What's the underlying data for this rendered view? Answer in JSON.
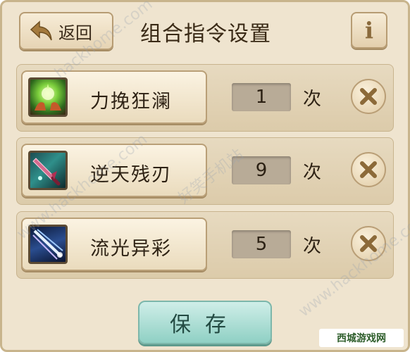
{
  "header": {
    "back_label": "返回",
    "title": "组合指令设置",
    "info_label": "i"
  },
  "skills": [
    {
      "name": "力挽狂澜",
      "count": "1",
      "unit": "次",
      "icon": "green-energy-hands-icon"
    },
    {
      "name": "逆天残刃",
      "count": "9",
      "unit": "次",
      "icon": "crystal-sword-icon"
    },
    {
      "name": "流光异彩",
      "count": "5",
      "unit": "次",
      "icon": "light-beam-slash-icon"
    }
  ],
  "save_label": "保存",
  "watermarks": [
    "hackhome.com",
    "www.hackhome.com",
    "好笑手机站"
  ],
  "logo_text": "西城游戏网",
  "colors": {
    "panel": "#efe4cf",
    "save_button": "#8fd0c4",
    "count_box": "#b8ab97"
  }
}
